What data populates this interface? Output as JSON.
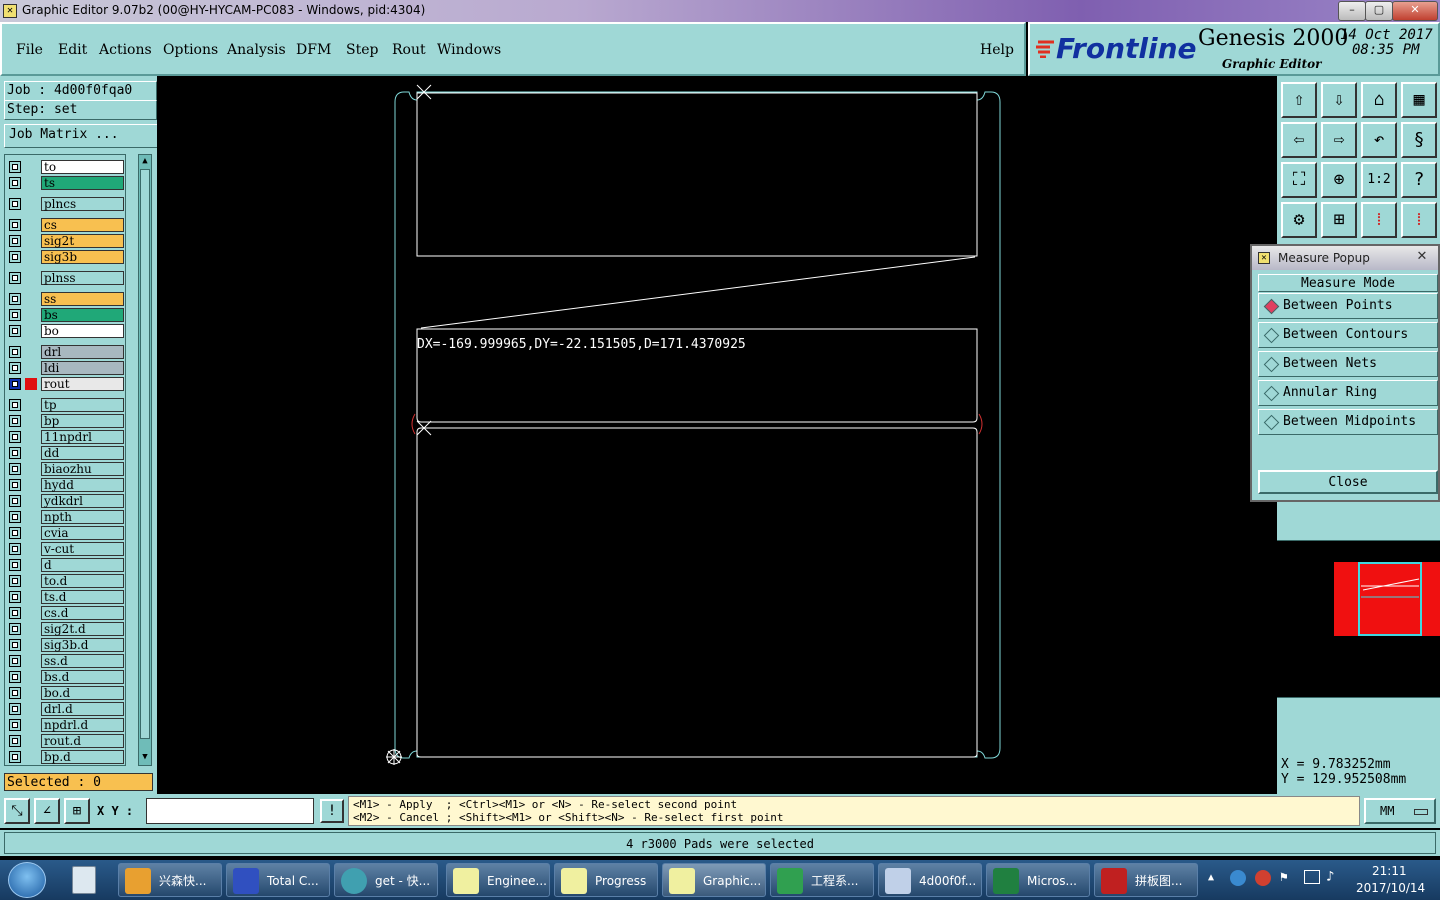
{
  "window": {
    "title": "Graphic Editor 9.07b2 (00@HY-HYCAM-PC083 - Windows, pid:4304)",
    "buttons": [
      "–",
      "▢",
      "✕"
    ]
  },
  "menu": {
    "items": [
      "File",
      "Edit",
      "Actions",
      "Options",
      "Analysis",
      "DFM",
      "Step",
      "Rout",
      "Windows"
    ],
    "help": "Help"
  },
  "brand": {
    "logo": "Frontline",
    "product": "Genesis 2000",
    "subtitle": "Graphic Editor",
    "date": "14 Oct 2017",
    "time": "08:35 PM"
  },
  "job": {
    "job_line": "Job : 4d00f0fqa0",
    "step_line": "Step: set",
    "matrix_button": "Job Matrix ..."
  },
  "layers": [
    {
      "name": "to",
      "color": "#ffffff"
    },
    {
      "name": "ts",
      "color": "#20a878"
    },
    {
      "name": "plncs",
      "color": "#9fd8d6"
    },
    {
      "name": "cs",
      "color": "#f8c050"
    },
    {
      "name": "sig2t",
      "color": "#f8c050"
    },
    {
      "name": "sig3b",
      "color": "#f8c050"
    },
    {
      "name": "plnss",
      "color": "#9fd8d6"
    },
    {
      "name": "ss",
      "color": "#f8c050"
    },
    {
      "name": "bs",
      "color": "#20a878"
    },
    {
      "name": "bo",
      "color": "#ffffff"
    },
    {
      "name": "drl",
      "color": "#a8b8c0"
    },
    {
      "name": "ldi",
      "color": "#a8b8c0"
    },
    {
      "name": "rout",
      "color": "#e8e8e8"
    },
    {
      "name": "tp",
      "color": "#9fd8d6"
    },
    {
      "name": "bp",
      "color": "#9fd8d6"
    },
    {
      "name": "11npdrl",
      "color": "#9fd8d6"
    },
    {
      "name": "dd",
      "color": "#9fd8d6"
    },
    {
      "name": "biaozhu",
      "color": "#9fd8d6"
    },
    {
      "name": "hydd",
      "color": "#9fd8d6"
    },
    {
      "name": "ydkdrl",
      "color": "#9fd8d6"
    },
    {
      "name": "npth",
      "color": "#9fd8d6"
    },
    {
      "name": "cvia",
      "color": "#9fd8d6"
    },
    {
      "name": "v-cut",
      "color": "#9fd8d6"
    },
    {
      "name": "d",
      "color": "#9fd8d6"
    },
    {
      "name": "to.d",
      "color": "#9fd8d6"
    },
    {
      "name": "ts.d",
      "color": "#9fd8d6"
    },
    {
      "name": "cs.d",
      "color": "#9fd8d6"
    },
    {
      "name": "sig2t.d",
      "color": "#9fd8d6"
    },
    {
      "name": "sig3b.d",
      "color": "#9fd8d6"
    },
    {
      "name": "ss.d",
      "color": "#9fd8d6"
    },
    {
      "name": "bs.d",
      "color": "#9fd8d6"
    },
    {
      "name": "bo.d",
      "color": "#9fd8d6"
    },
    {
      "name": "drl.d",
      "color": "#9fd8d6"
    },
    {
      "name": "npdrl.d",
      "color": "#9fd8d6"
    },
    {
      "name": "rout.d",
      "color": "#9fd8d6"
    },
    {
      "name": "bp.d",
      "color": "#9fd8d6"
    }
  ],
  "selected_text": "Selected : 0",
  "canvas": {
    "measure_text": "DX=-169.999965,DY=-22.151505,D=171.4370925",
    "outline_color": "#7fd8d8",
    "highlight_color": "#d03030"
  },
  "measure_popup": {
    "title": "Measure Popup",
    "heading": "Measure Mode",
    "options": [
      "Between Points",
      "Between Contours",
      "Between Nets",
      "Annular Ring",
      "Between Midpoints"
    ],
    "selected": "Between Points",
    "close": "Close"
  },
  "coords": {
    "x": "X  =  9.783252mm",
    "y": "Y  =  129.952508mm"
  },
  "command": {
    "xy_label": "X Y :",
    "input_value": "",
    "hint1": "<M1> - Apply  ; <Ctrl><M1> or <N> - Re-select second point",
    "hint2": "<M2> - Cancel ; <Shift><M1> or <Shift><N> - Re-select first point",
    "units": "MM"
  },
  "status": "4 r3000 Pads were selected",
  "taskbar": {
    "items": [
      "兴森快...",
      "Total C...",
      "get - 快...",
      "Enginee...",
      "Progress",
      "Graphic...",
      "工程系...",
      "4d00f0f...",
      "Micros...",
      "拼板图..."
    ],
    "time": "21:11",
    "date": "2017/10/14"
  }
}
